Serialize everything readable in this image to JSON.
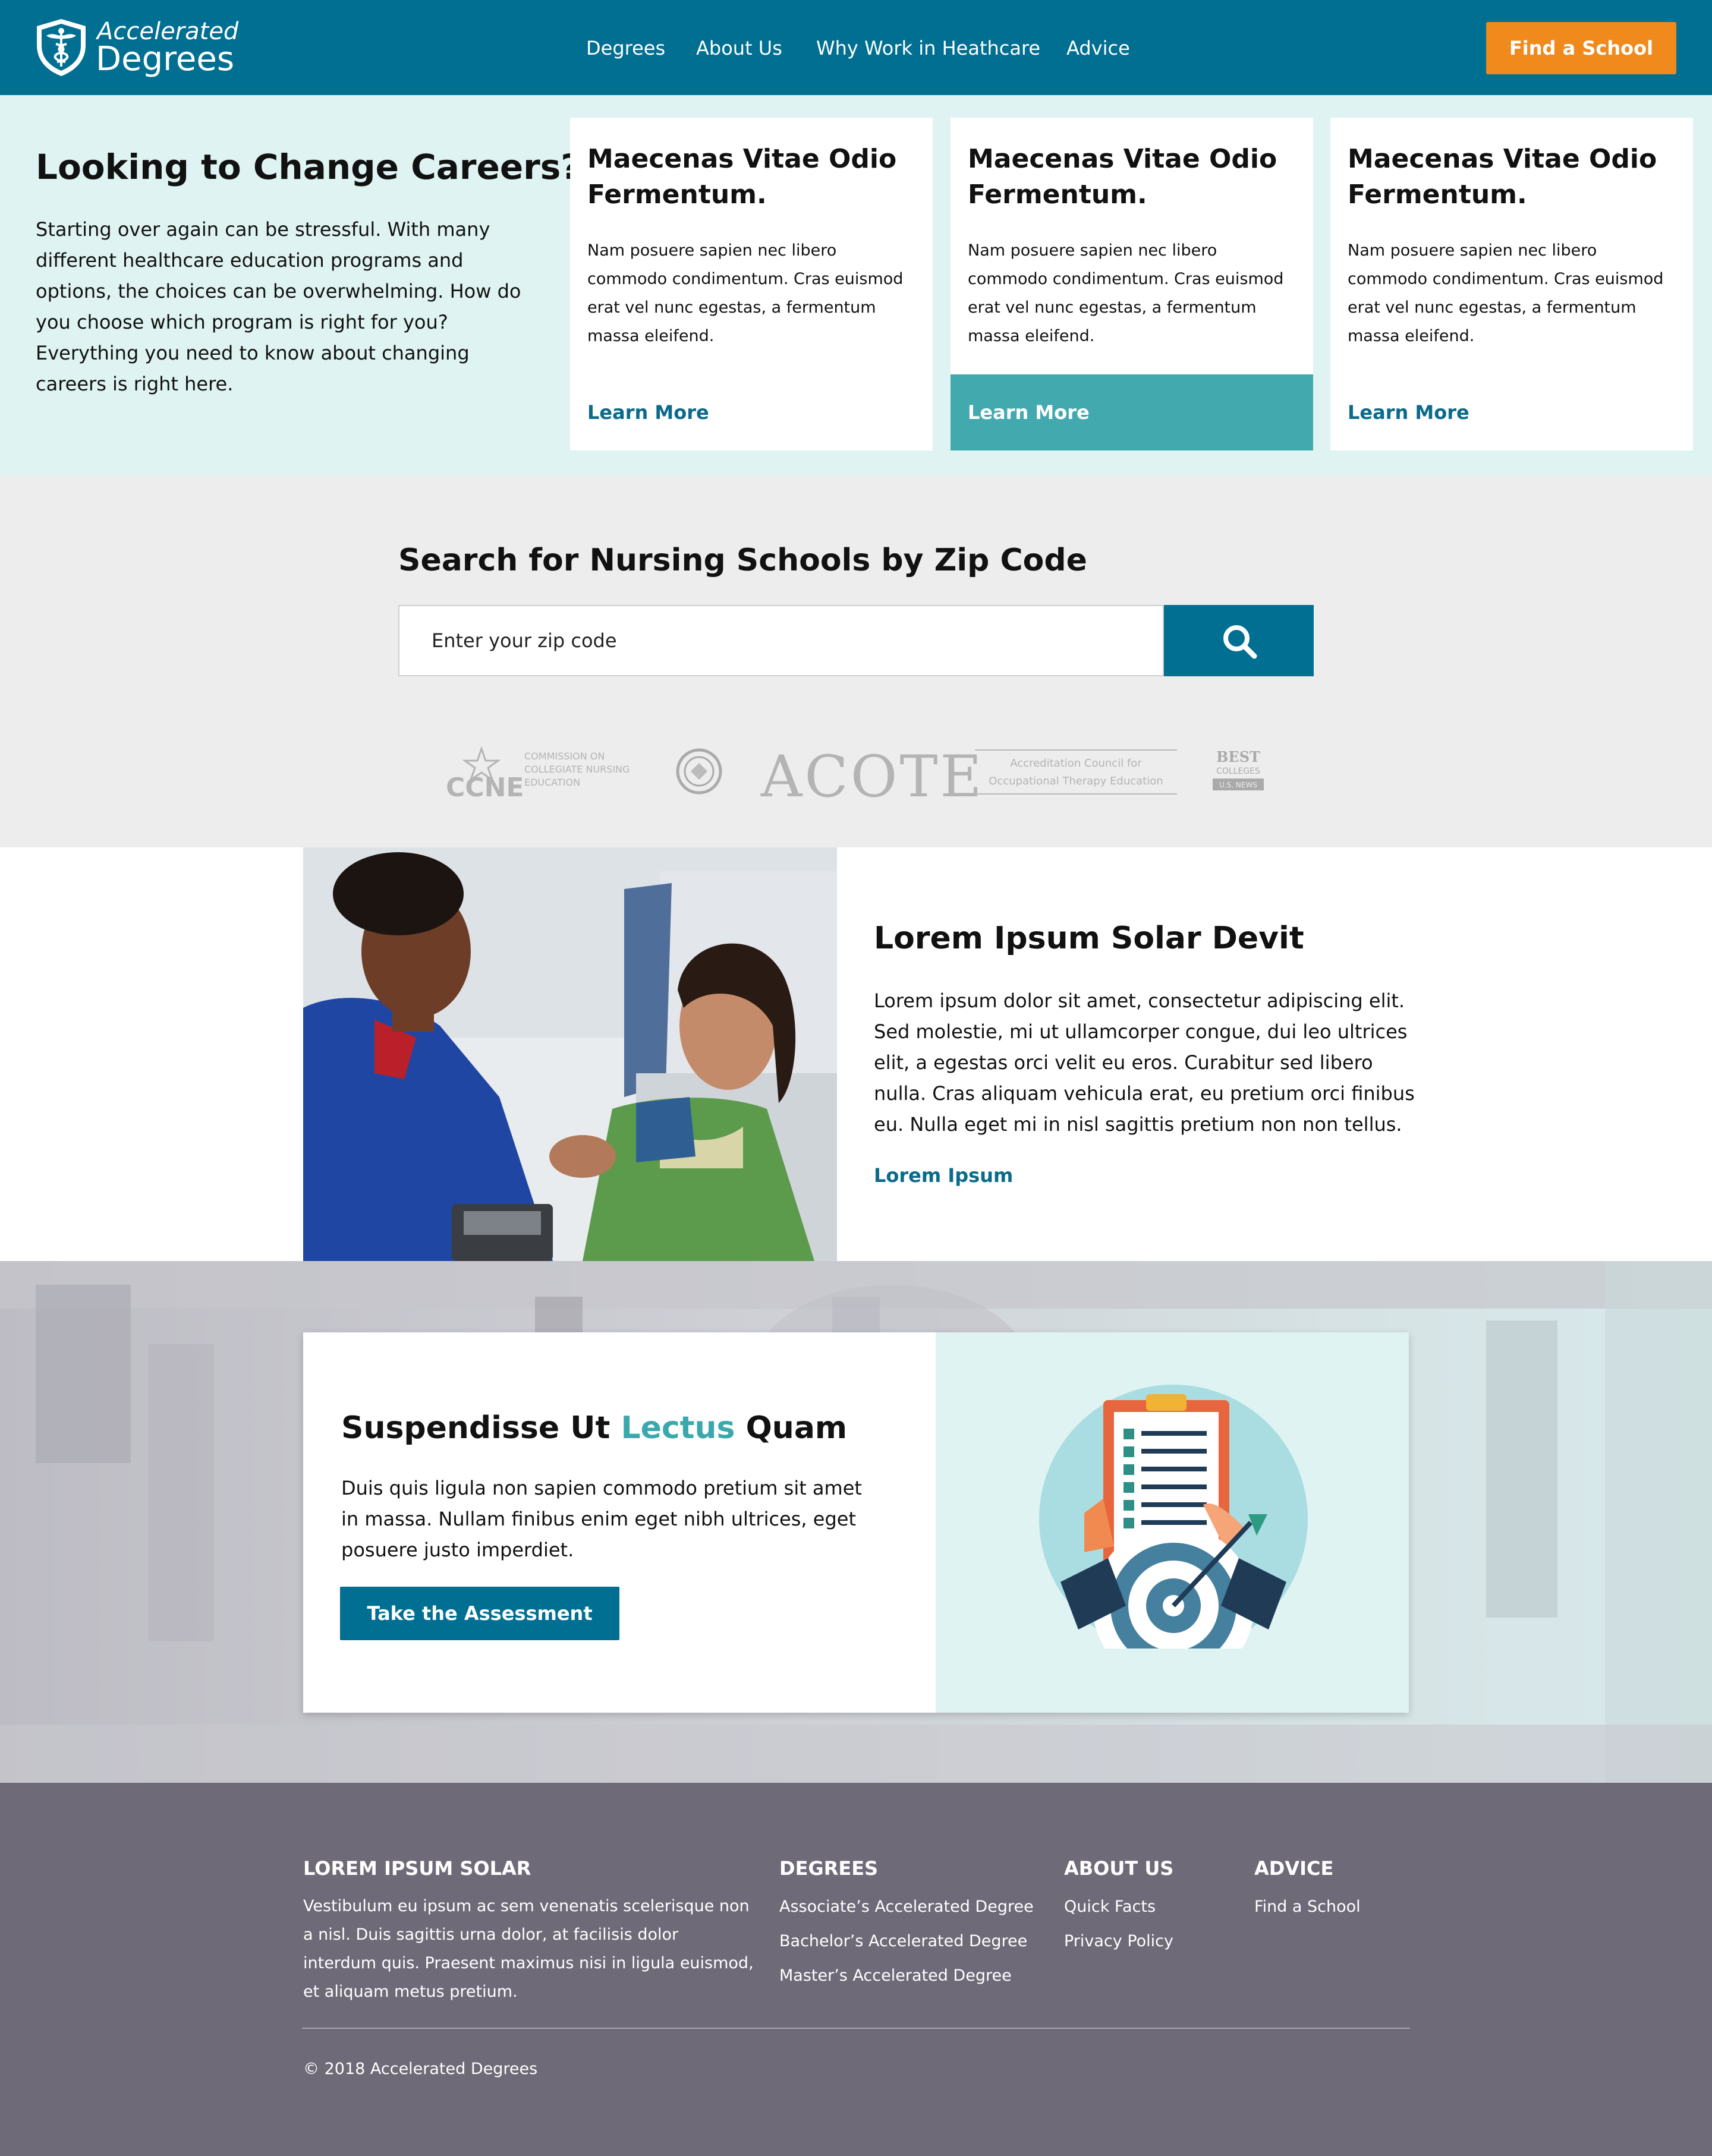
{
  "header": {
    "logo_line1": "Accelerated",
    "logo_line2": "Degrees",
    "nav": [
      "Degrees",
      "About Us",
      "Why Work in Heathcare",
      "Advice"
    ],
    "cta_label": "Find a School"
  },
  "careers": {
    "heading": "Looking to Change Careers?",
    "body": "Starting over again can be stressful. With many different healthcare education programs and options, the choices can be overwhelming. How do you choose which program is right for you? Everything you need to know about changing careers is right here.",
    "cards": [
      {
        "title": "Maecenas Vitae Odio Fermentum.",
        "body": "Nam posuere sapien nec libero commodo condimentum. Cras euismod erat vel nunc egestas, a fermentum massa eleifend.",
        "link": "Learn More"
      },
      {
        "title": "Maecenas Vitae Odio Fermentum.",
        "body": "Nam posuere sapien nec libero commodo condimentum. Cras euismod erat vel nunc egestas, a fermentum massa eleifend.",
        "link": "Learn More"
      },
      {
        "title": "Maecenas Vitae Odio Fermentum.",
        "body": "Nam posuere sapien nec libero commodo condimentum. Cras euismod erat vel nunc egestas, a fermentum massa eleifend.",
        "link": "Learn More"
      }
    ]
  },
  "search": {
    "heading": "Search for Nursing Schools by Zip Code",
    "placeholder": "Enter your zip code",
    "accreditation": {
      "ccne": "CCNE",
      "ccne_sub": [
        "COMMISSION ON",
        "COLLEGIATE NURSING",
        "EDUCATION"
      ],
      "acote": "ACOTE",
      "acote_sub": [
        "Accreditation Council for",
        "Occupational Therapy Education"
      ],
      "best": [
        "BEST",
        "COLLEGES",
        "U.S. NEWS"
      ]
    }
  },
  "feature": {
    "heading": "Lorem Ipsum Solar Devit",
    "body": "Lorem ipsum dolor sit amet, consectetur adipiscing elit. Sed molestie, mi ut ullamcorper congue, dui leo ultrices elit, a egestas orci velit eu eros. Curabitur sed libero nulla. Cras aliquam vehicula erat, eu pretium orci finibus eu. Nulla eget mi in nisl sagittis pretium non non tellus.",
    "link": "Lorem Ipsum"
  },
  "assessment": {
    "heading_pre": "Suspendisse Ut ",
    "heading_highlight": "Lectus",
    "heading_post": " Quam",
    "body": "Duis quis ligula non sapien commodo pretium sit amet in massa. Nullam finibus enim eget nibh ultrices, eget posuere justo imperdiet.",
    "button": "Take the Assessment"
  },
  "footer": {
    "col1_title": "LOREM IPSUM SOLAR",
    "col1_body": "Vestibulum eu ipsum ac sem venenatis scelerisque non a nisl. Duis sagittis urna dolor, at facilisis dolor interdum quis. Praesent maximus nisi in ligula euismod, et aliquam metus pretium.",
    "col2_title": "DEGREES",
    "col2_links": [
      "Associate’s Accelerated Degree",
      "Bachelor’s Accelerated Degree",
      "Master’s Accelerated Degree"
    ],
    "col3_title": "ABOUT US",
    "col3_links": [
      "Quick Facts",
      "Privacy Policy"
    ],
    "col4_title": "ADVICE",
    "col4_links": [
      "Find a School"
    ],
    "copyright": "© 2018 Accelerated Degrees"
  },
  "colors": {
    "brand_blue": "#006f92",
    "orange": "#f08a1c",
    "teal": "#42aaaf",
    "light_teal": "#def3f2",
    "footer": "#6e6a78"
  }
}
